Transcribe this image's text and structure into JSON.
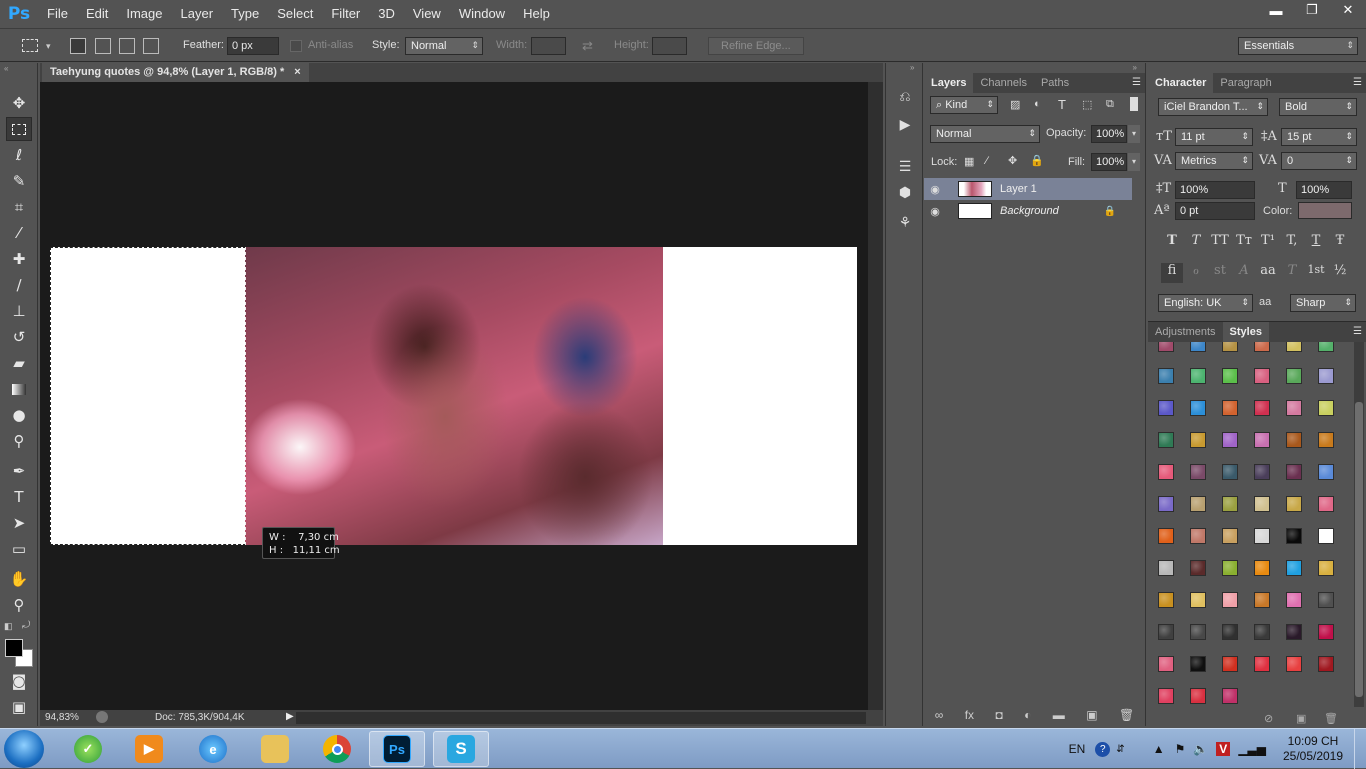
{
  "app": {
    "logo": "Ps"
  },
  "menu": [
    "File",
    "Edit",
    "Image",
    "Layer",
    "Type",
    "Select",
    "Filter",
    "3D",
    "View",
    "Window",
    "Help"
  ],
  "window_controls": {
    "minimize": "▬",
    "restore": "❐",
    "close": "✕"
  },
  "options": {
    "feather_label": "Feather:",
    "feather_value": "0 px",
    "antialias_label": "Anti-alias",
    "style_label": "Style:",
    "style_value": "Normal",
    "width_label": "Width:",
    "height_label": "Height:",
    "refine_edge": "Refine Edge...",
    "workspace": "Essentials"
  },
  "document": {
    "tab_title": "Taehyung quotes @ 94,8% (Layer 1, RGB/8) *",
    "tab_close": "×",
    "tooltip": "W :    7,30 cm\nH :   11,11 cm",
    "zoom": "94,83%",
    "doc_info": "Doc: 785,3K/904,4K"
  },
  "layers_panel": {
    "tabs": [
      "Layers",
      "Channels",
      "Paths"
    ],
    "kind": "Kind",
    "blend_mode": "Normal",
    "opacity_label": "Opacity:",
    "opacity_value": "100%",
    "lock_label": "Lock:",
    "fill_label": "Fill:",
    "fill_value": "100%",
    "layers": [
      {
        "name": "Layer 1"
      },
      {
        "name": "Background"
      }
    ],
    "footer_icons": [
      "∞",
      "fx",
      "◘",
      "◐",
      "▬",
      "▣",
      "🗑"
    ]
  },
  "character_panel": {
    "tabs": [
      "Character",
      "Paragraph"
    ],
    "font_family": "iCiel Brandon T...",
    "font_style": "Bold",
    "font_size": "11 pt",
    "leading": "15 pt",
    "kerning": "Metrics",
    "tracking": "0",
    "vertical_scale": "100%",
    "horizontal_scale": "100%",
    "baseline_shift": "0 pt",
    "color_label": "Color:",
    "color_value": "#7d6a6d",
    "type_buttons": [
      "T",
      "T",
      "TT",
      "Tт",
      "T¹",
      "T,",
      "T",
      "Ŧ"
    ],
    "opentype_buttons": [
      "ﬁ",
      "ℴ",
      "st",
      "A",
      "aa",
      "T",
      "1st",
      "½"
    ],
    "language": "English: UK",
    "antialias_icon": "aa",
    "antialias": "Sharp"
  },
  "styles_panel": {
    "tabs": [
      "Adjustments",
      "Styles"
    ],
    "swatches": [
      "#a04a6a",
      "#3d86c8",
      "#b59244",
      "#cc6a4b",
      "#d2c060",
      "#54b06a",
      "#3b7fae",
      "#4cb36f",
      "#5bbf4a",
      "#d86080",
      "#59a85a",
      "#9b9ad0",
      "#5b58c8",
      "#2c8fd8",
      "#d2632f",
      "#d03050",
      "#d47aa0",
      "#c9d060",
      "#2f7a55",
      "#c89a30",
      "#a064c8",
      "#c870b0",
      "#a8581c",
      "#c87a1c",
      "#e65a7a",
      "#7a4a68",
      "#3a5a6a",
      "#4a3e5a",
      "#6a3050",
      "#5a8ad8",
      "#7a6ac8",
      "#b8a070",
      "#9aa040",
      "#d0c090",
      "#c8a848",
      "#e06888",
      "#e0601a",
      "#c07868",
      "#c8a060",
      "#d8d8d8",
      "#0a0a0a",
      "#ffffff",
      "#b8b8b8",
      "#5a2a2a",
      "#8ab030",
      "#e88a10",
      "#20a0e0",
      "#d8b040",
      "#c89020",
      "#e0c060",
      "#f0a0a8",
      "#c87828",
      "#e070b0",
      "#505050",
      "#404040",
      "#484848",
      "#303030",
      "#3a3a3a",
      "#2a1a2a",
      "#c0104a",
      "#e06080",
      "#101010",
      "#d03020",
      "#e03040",
      "#e84040",
      "#a01820",
      "#e04060",
      "#d83040",
      "#c03068"
    ]
  }
}
